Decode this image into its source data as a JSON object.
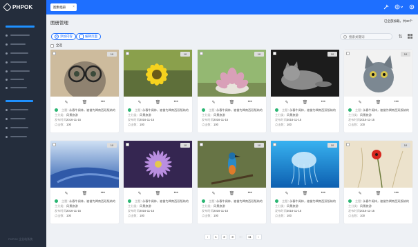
{
  "app": {
    "logo": "PHPOK",
    "version": "PHPOK 企业站系统"
  },
  "sidebar": {
    "items": [
      "",
      "",
      "",
      "",
      "",
      "",
      "",
      "",
      "",
      "",
      "",
      ""
    ]
  },
  "topbar": {
    "tab_label": "图集相册",
    "tab_close": "×",
    "icons": [
      "clear-cache-icon",
      "globe-icon",
      "settings-icon"
    ]
  },
  "page": {
    "title": "图册管理",
    "meta": "已全部加载，共30个"
  },
  "toolbar": {
    "add_label": "添加内容",
    "edit_label": "编辑页面",
    "search_placeholder": "搜索关键词",
    "select_all": "全选"
  },
  "card_labels": {
    "theme": "主题：",
    "category": "主分类：",
    "date": "发布时间：",
    "views": "点击数："
  },
  "cards": [
    {
      "count": "10",
      "theme": "永春牛阁林，被誉为褐南西双版纳的",
      "category": "风景旅游",
      "date": "2016-11-15",
      "views": "100"
    },
    {
      "count": "10",
      "theme": "永春牛阁林，被誉为褐南西双版纳的",
      "category": "风景旅游",
      "date": "2016-11-15",
      "views": "100"
    },
    {
      "count": "10",
      "theme": "永春牛阁林，被誉为褐南西双版纳的",
      "category": "风景旅游",
      "date": "2016-11-15",
      "views": "100"
    },
    {
      "count": "10",
      "theme": "永春牛阁林，被誉为褐南西双版纳的",
      "category": "风景旅游",
      "date": "2016-11-15",
      "views": "100"
    },
    {
      "count": "10",
      "theme": "永春牛阁林，被誉为褐南西双版纳的",
      "category": "风景旅游",
      "date": "2016-11-15",
      "views": "100"
    },
    {
      "count": "10",
      "theme": "永春牛阁林，被誉为褐南西双版纳的",
      "category": "风景旅游",
      "date": "2016-11-15",
      "views": "100"
    },
    {
      "count": "10",
      "theme": "永春牛阁林，被誉为褐南西双版纳的",
      "category": "风景旅游",
      "date": "2016-11-15",
      "views": "100"
    },
    {
      "count": "10",
      "theme": "永春牛阁林，被誉为褐南西双版纳的",
      "category": "风景旅游",
      "date": "2016-11-15",
      "views": "100"
    },
    {
      "count": "10",
      "theme": "永春牛阁林，被誉为褐南西双版纳的",
      "category": "风景旅游",
      "date": "2016-11-15",
      "views": "100"
    },
    {
      "count": "10",
      "theme": "永春牛阁林，被誉为褐南西双版纳的",
      "category": "风景旅游",
      "date": "2016-11-15",
      "views": "100"
    }
  ],
  "pagination": {
    "prev": "‹",
    "pages": [
      "1",
      "2",
      "3"
    ],
    "dots": "···",
    "last": "11",
    "next": "›"
  },
  "colors": {
    "accent": "#1e6fff",
    "sidebar": "#242d3c",
    "success": "#2bb673"
  }
}
